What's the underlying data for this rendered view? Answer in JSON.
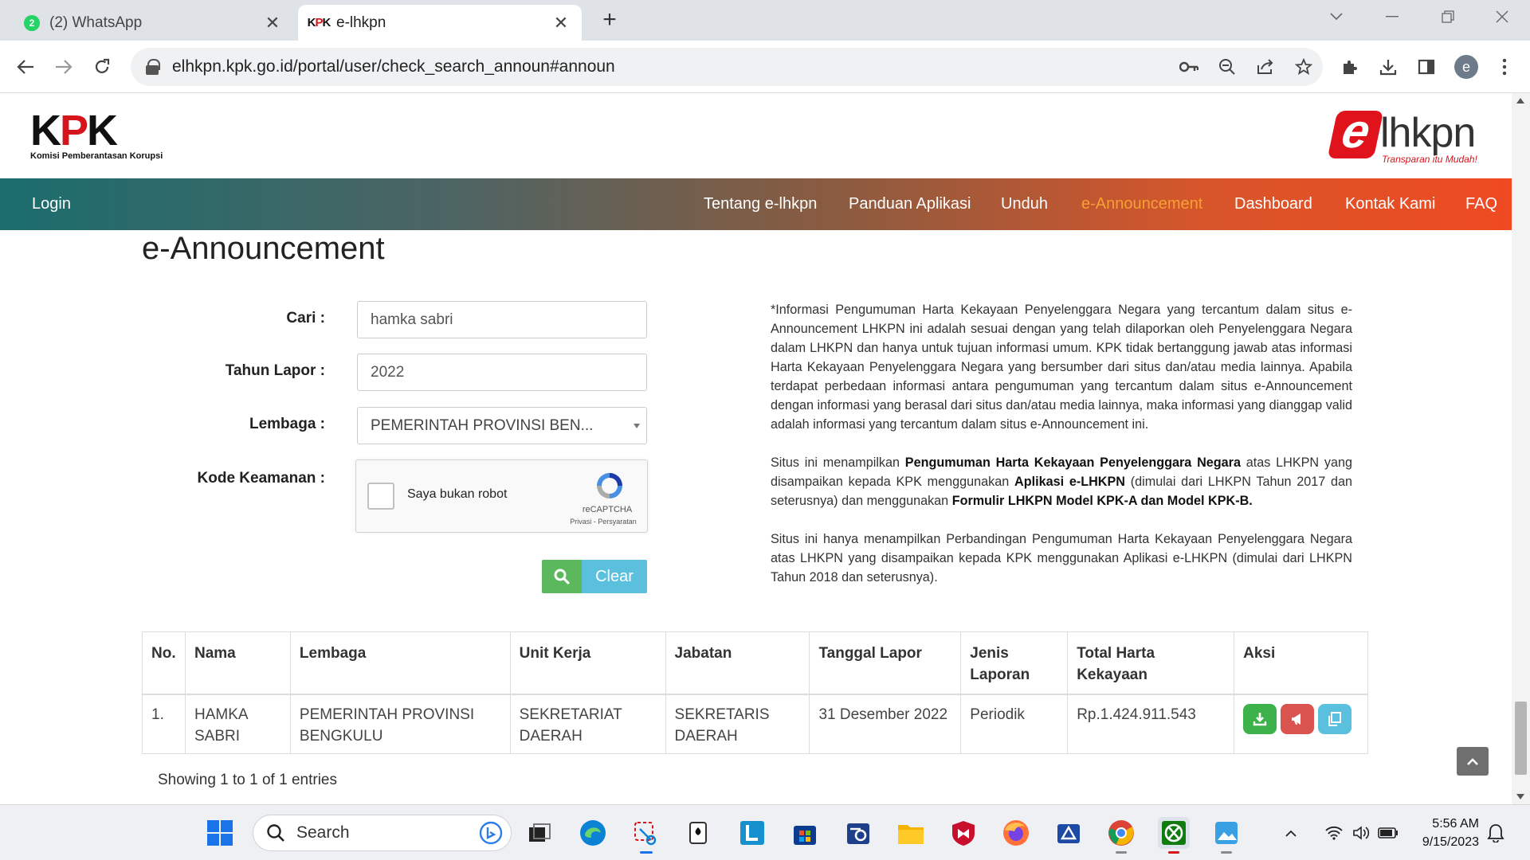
{
  "browser": {
    "tabs": [
      {
        "title": "(2) WhatsApp",
        "badge": "2",
        "active": false
      },
      {
        "title": "e-lhkpn",
        "active": true
      }
    ],
    "url": "elhkpn.kpk.go.id/portal/user/check_search_announ#announ",
    "profile_initial": "e"
  },
  "site": {
    "kpk_logo": {
      "text_k": "K",
      "text_p": "P",
      "text_k2": "K",
      "subtitle": "Komisi Pemberantasan Korupsi"
    },
    "elhkpn_logo": {
      "e": "e",
      "word": "lhkpn",
      "tagline": "Transparan itu Mudah!"
    },
    "nav": {
      "login": "Login",
      "items": [
        {
          "label": "Tentang e-lhkpn"
        },
        {
          "label": "Panduan Aplikasi"
        },
        {
          "label": "Unduh"
        },
        {
          "label": "e-Announcement",
          "active": true
        },
        {
          "label": "Dashboard"
        },
        {
          "label": "Kontak Kami"
        },
        {
          "label": "FAQ"
        }
      ],
      "active_color": "#f7a035"
    },
    "page_title": "e-Announcement"
  },
  "form": {
    "cari_label": "Cari :",
    "cari_value": "hamka sabri",
    "tahun_label": "Tahun Lapor :",
    "tahun_value": "2022",
    "lembaga_label": "Lembaga :",
    "lembaga_value": "PEMERINTAH PROVINSI BEN...",
    "kode_label": "Kode Keamanan :",
    "captcha_label": "Saya bukan robot",
    "captcha_brand": "reCAPTCHA",
    "captcha_terms": "Privasi - Persyaratan",
    "clear_label": "Clear"
  },
  "disclaimer": {
    "p1": "*Informasi Pengumuman Harta Kekayaan Penyelenggara Negara yang tercantum dalam situs e-Announcement LHKPN ini adalah sesuai dengan yang telah dilaporkan oleh Penyelenggara Negara dalam LHKPN dan hanya untuk tujuan informasi umum. KPK tidak bertanggung jawab atas informasi Harta Kekayaan Penyelenggara Negara yang bersumber dari situs dan/atau media lainnya. Apabila terdapat perbedaan informasi antara pengumuman yang tercantum dalam situs e-Announcement dengan informasi yang berasal dari situs dan/atau media lainnya, maka informasi yang dianggap valid adalah informasi yang tercantum dalam situs e-Announcement ini.",
    "p2_a": "Situs ini menampilkan ",
    "p2_b": "Pengumuman Harta Kekayaan Penyelenggara Negara",
    "p2_c": " atas LHKPN yang disampaikan kepada KPK menggunakan ",
    "p2_d": "Aplikasi e-LHKPN",
    "p2_e": " (dimulai dari LHKPN Tahun 2017 dan seterusnya) dan menggunakan ",
    "p2_f": "Formulir LHKPN Model KPK-A dan Model KPK-B.",
    "p3": "Situs ini hanya menampilkan Perbandingan Pengumuman Harta Kekayaan Penyelenggara Negara atas LHKPN yang disampaikan kepada KPK menggunakan Aplikasi e-LHKPN (dimulai dari LHKPN Tahun 2018 dan seterusnya)."
  },
  "table": {
    "headers": [
      "No.",
      "Nama",
      "Lembaga",
      "Unit Kerja",
      "Jabatan",
      "Tanggal Lapor",
      "Jenis Laporan",
      "Total Harta Kekayaan",
      "Aksi"
    ],
    "rows": [
      {
        "no": "1.",
        "nama": "HAMKA SABRI",
        "lembaga": "PEMERINTAH PROVINSI BENGKULU",
        "unit_kerja": "SEKRETARIAT DAERAH",
        "jabatan": "SEKRETARIS DAERAH",
        "tanggal": "31 Desember 2022",
        "jenis": "Periodik",
        "total": "Rp.1.424.911.543"
      }
    ],
    "showing": "Showing 1 to 1 of 1 entries"
  },
  "taskbar": {
    "search_label": "Search",
    "time": "5:56 AM",
    "date": "9/15/2023"
  },
  "colors": {
    "kpk_red": "#d6141b",
    "nav_start": "#1b6d6e",
    "nav_end": "#ef4a22",
    "btn_green": "#5cb85c",
    "btn_blue": "#5bc0de",
    "btn_red": "#d9534f"
  }
}
